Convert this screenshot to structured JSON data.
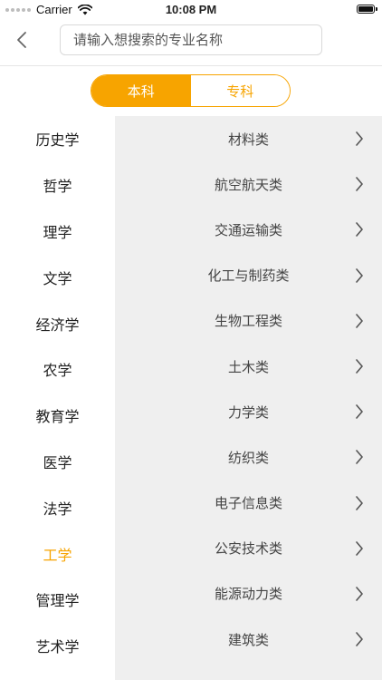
{
  "status_bar": {
    "carrier": "Carrier",
    "time": "10:08 PM"
  },
  "search": {
    "placeholder": "请输入想搜索的专业名称"
  },
  "tabs": [
    {
      "label": "本科",
      "active": true
    },
    {
      "label": "专科",
      "active": false
    }
  ],
  "categories": [
    {
      "label": "历史学"
    },
    {
      "label": "哲学"
    },
    {
      "label": "理学"
    },
    {
      "label": "文学"
    },
    {
      "label": "经济学"
    },
    {
      "label": "农学"
    },
    {
      "label": "教育学"
    },
    {
      "label": "医学"
    },
    {
      "label": "法学"
    },
    {
      "label": "工学"
    },
    {
      "label": "管理学"
    },
    {
      "label": "艺术学"
    }
  ],
  "selected_category": "工学",
  "subcategories": [
    {
      "label": "材料类"
    },
    {
      "label": "航空航天类"
    },
    {
      "label": "交通运输类"
    },
    {
      "label": "化工与制药类"
    },
    {
      "label": "生物工程类"
    },
    {
      "label": "土木类"
    },
    {
      "label": "力学类"
    },
    {
      "label": "纺织类"
    },
    {
      "label": "电子信息类"
    },
    {
      "label": "公安技术类"
    },
    {
      "label": "能源动力类"
    },
    {
      "label": "建筑类"
    }
  ],
  "colors": {
    "accent": "#f7a400",
    "panel_bg": "#efefef"
  },
  "icons": {
    "back": "chevron-left-icon",
    "row": "chevron-right-icon",
    "wifi": "wifi-icon",
    "battery": "battery-icon"
  }
}
